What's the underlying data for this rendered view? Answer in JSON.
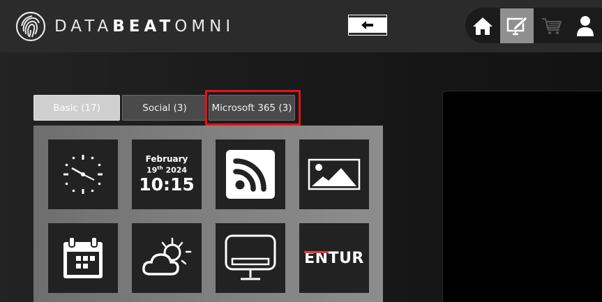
{
  "app": {
    "logo_light": "DATA",
    "logo_bold": "BEAT",
    "logo_light2": "OMNI"
  },
  "header": {
    "back_icon": "arrow-left-icon",
    "nav": [
      {
        "icon": "home-icon",
        "active": false
      },
      {
        "icon": "edit-screen-icon",
        "active": true
      },
      {
        "icon": "cart-icon",
        "active": false
      },
      {
        "icon": "user-icon",
        "active": false
      }
    ]
  },
  "tabs": [
    {
      "label": "Basic (17)",
      "selected": false
    },
    {
      "label": "Social (3)",
      "selected": false
    },
    {
      "label": "Microsoft 365 (3)",
      "selected": true
    }
  ],
  "widgets": {
    "clock": {
      "icon": "clock-icon"
    },
    "date_time": {
      "month": "February",
      "day": "19",
      "day_suffix": "th",
      "year": "2024",
      "time": "10:15"
    },
    "rss": {
      "icon": "rss-icon"
    },
    "image": {
      "icon": "image-icon"
    },
    "calendar": {
      "icon": "calendar-icon"
    },
    "weather": {
      "icon": "weather-icon"
    },
    "display": {
      "icon": "display-icon"
    },
    "entur": {
      "logo_a": "EN",
      "logo_b": "TUR"
    }
  },
  "colors": {
    "highlight": "#e3131b",
    "entur_red": "#e63b3b",
    "active_nav": "#8f8f8f"
  }
}
